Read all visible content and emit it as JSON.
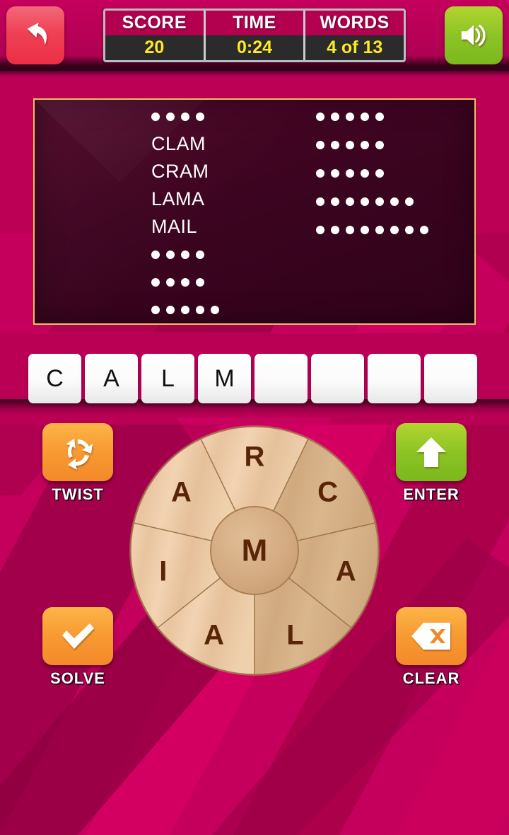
{
  "header": {
    "back_button": {
      "name": "back",
      "icon": "back-arrow-icon",
      "color": "#ec2f46"
    },
    "sound_button": {
      "name": "sound",
      "icon": "speaker-icon",
      "color": "#8cc425"
    },
    "scoreboard": [
      {
        "label": "SCORE",
        "value": "20"
      },
      {
        "label": "TIME",
        "value": "0:24"
      },
      {
        "label": "WORDS",
        "value": "4 of 13"
      }
    ],
    "label_color": "#ffffff",
    "value_color": "#ffe923"
  },
  "word_panel": {
    "border_color": "#f0c060",
    "background_color": "#3c0420",
    "left_column": [
      {
        "solved": false,
        "length": 4,
        "text": ""
      },
      {
        "solved": true,
        "length": 4,
        "text": "CLAM"
      },
      {
        "solved": true,
        "length": 4,
        "text": "CRAM"
      },
      {
        "solved": true,
        "length": 4,
        "text": "LAMA"
      },
      {
        "solved": true,
        "length": 4,
        "text": "MAIL"
      },
      {
        "solved": false,
        "length": 4,
        "text": ""
      },
      {
        "solved": false,
        "length": 4,
        "text": ""
      },
      {
        "solved": false,
        "length": 5,
        "text": ""
      }
    ],
    "right_column": [
      {
        "solved": false,
        "length": 5,
        "text": ""
      },
      {
        "solved": false,
        "length": 5,
        "text": ""
      },
      {
        "solved": false,
        "length": 5,
        "text": ""
      },
      {
        "solved": false,
        "length": 7,
        "text": ""
      },
      {
        "solved": false,
        "length": 8,
        "text": ""
      }
    ]
  },
  "tiles": [
    {
      "letter": "C"
    },
    {
      "letter": "A"
    },
    {
      "letter": "L"
    },
    {
      "letter": "M"
    },
    {
      "letter": ""
    },
    {
      "letter": ""
    },
    {
      "letter": ""
    },
    {
      "letter": ""
    }
  ],
  "current_word": "CALM",
  "wheel": {
    "center": {
      "letter": "M",
      "selected": true
    },
    "segments": [
      {
        "letter": "R",
        "selected": false,
        "position": "top"
      },
      {
        "letter": "C",
        "selected": true,
        "position": "upper-right"
      },
      {
        "letter": "A",
        "selected": true,
        "position": "right"
      },
      {
        "letter": "L",
        "selected": true,
        "position": "bottom"
      },
      {
        "letter": "A",
        "selected": false,
        "position": "lower-left"
      },
      {
        "letter": "I",
        "selected": false,
        "position": "left"
      },
      {
        "letter": "A",
        "selected": false,
        "position": "upper-left"
      }
    ],
    "letter_color": "#5a2408",
    "wood_light": "#f0cfae",
    "wood_dark": "#d4ab7f"
  },
  "actions": [
    {
      "id": "twist",
      "label": "TWIST",
      "icon": "recycle-arrows-icon",
      "color": "#f79a32"
    },
    {
      "id": "enter",
      "label": "ENTER",
      "icon": "up-arrow-icon",
      "color": "#8cc425"
    },
    {
      "id": "solve",
      "label": "SOLVE",
      "icon": "checkmark-icon",
      "color": "#f79a32"
    },
    {
      "id": "clear",
      "label": "CLEAR",
      "icon": "backspace-x-icon",
      "color": "#f79a32"
    }
  ],
  "theme": {
    "background": "#c4005c",
    "stripe_dark": "#8e0040",
    "stripe_light": "#e00063"
  }
}
